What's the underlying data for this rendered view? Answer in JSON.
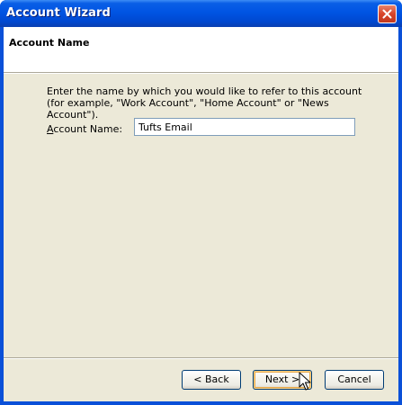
{
  "window": {
    "title": "Account Wizard"
  },
  "header": {
    "title": "Account Name"
  },
  "main": {
    "instructions": "Enter the name by which you would like to refer to this account (for example, \"Work Account\", \"Home Account\" or \"News Account\").",
    "account_name": {
      "label_accel": "A",
      "label_rest": "ccount Name:",
      "value": "Tufts Email"
    }
  },
  "buttons": {
    "back": "< Back",
    "next": "Next >",
    "cancel": "Cancel"
  },
  "icons": {
    "close": "close-icon",
    "cursor": "mouse-pointer-icon"
  },
  "colors": {
    "titlebar": "#0054e3",
    "close_button": "#d9442a",
    "dialog_bg": "#ece9d8",
    "default_button_ring": "#e5a64a"
  }
}
